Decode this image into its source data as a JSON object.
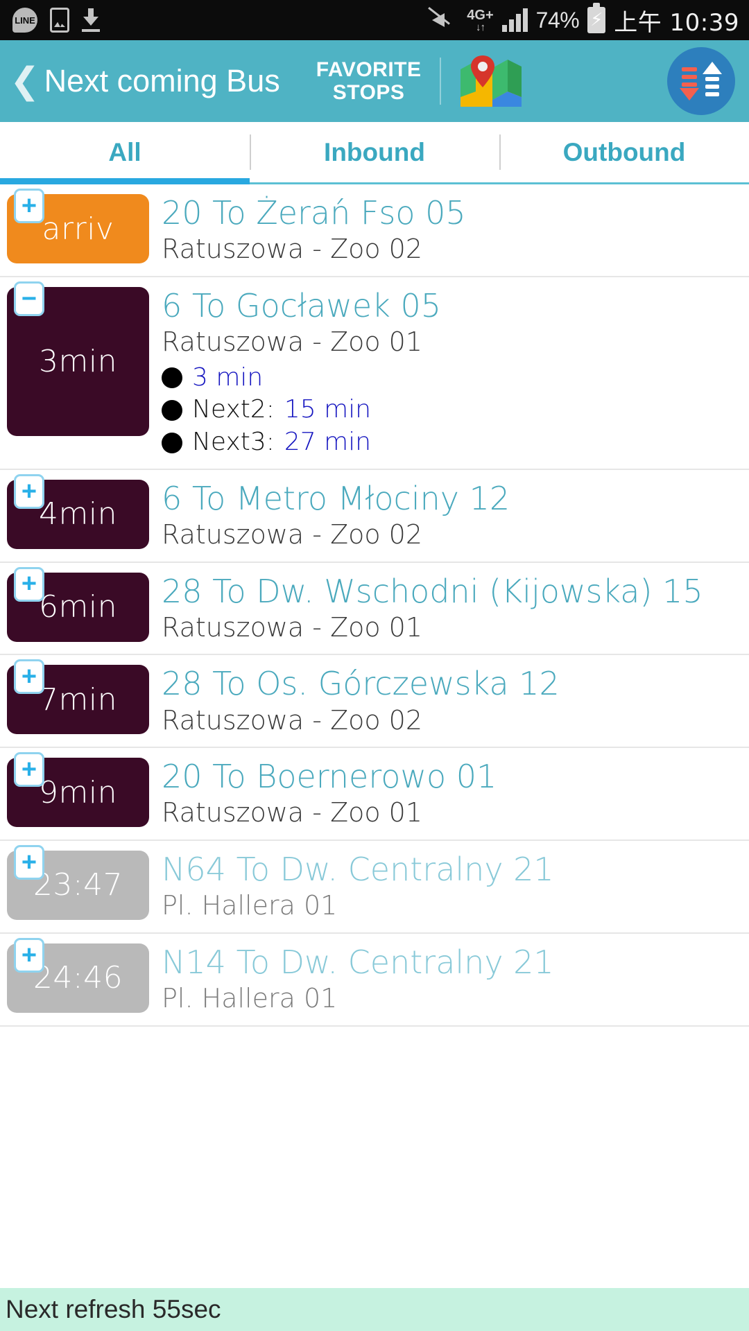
{
  "status_bar": {
    "line_label": "LINE",
    "network": "4G+",
    "network_arrows": "↓↑",
    "battery_percent": "74%",
    "time": "上午 10:39",
    "icons": [
      "line-icon",
      "gallery-icon",
      "download-icon",
      "mute-icon",
      "signal-icon",
      "battery-charging-icon"
    ]
  },
  "appbar": {
    "back_label": "❮",
    "title": "Next coming Bus",
    "favorite_stops_line1": "FAVORITE",
    "favorite_stops_line2": "STOPS",
    "map_icon": "map-icon",
    "sort_icon": "sort-updown-icon",
    "background_color": "#4fb3c4"
  },
  "tabs": [
    {
      "label": "All",
      "active": true
    },
    {
      "label": "Inbound",
      "active": false
    },
    {
      "label": "Outbound",
      "active": false
    }
  ],
  "rows": [
    {
      "badge": "arriv",
      "badge_style": "orange",
      "expander": "+",
      "route": "20 To Żerań Fso 05",
      "stop": "Ratuszowa - Zoo 02",
      "expanded": false,
      "dim": false
    },
    {
      "badge": "3min",
      "badge_style": "dark",
      "expander": "−",
      "route": "6 To Gocławek 05",
      "stop": "Ratuszowa - Zoo 01",
      "expanded": true,
      "dim": false,
      "next_times": [
        {
          "label": "",
          "value": "3 min"
        },
        {
          "label": "Next2:",
          "value": "15 min"
        },
        {
          "label": "Next3:",
          "value": "27 min"
        }
      ]
    },
    {
      "badge": "4min",
      "badge_style": "dark",
      "expander": "+",
      "route": "6 To Metro Młociny 12",
      "stop": "Ratuszowa - Zoo 02",
      "expanded": false,
      "dim": false
    },
    {
      "badge": "6min",
      "badge_style": "dark",
      "expander": "+",
      "route": "28 To Dw. Wschodni (Kijowska) 15",
      "stop": "Ratuszowa - Zoo 01",
      "expanded": false,
      "dim": false
    },
    {
      "badge": "7min",
      "badge_style": "dark",
      "expander": "+",
      "route": "28 To Os. Górczewska 12",
      "stop": "Ratuszowa - Zoo 02",
      "expanded": false,
      "dim": false
    },
    {
      "badge": "9min",
      "badge_style": "dark",
      "expander": "+",
      "route": "20 To Boernerowo 01",
      "stop": "Ratuszowa - Zoo 01",
      "expanded": false,
      "dim": false
    },
    {
      "badge": "23:47",
      "badge_style": "gray",
      "expander": "+",
      "route": "N64 To Dw. Centralny 21",
      "stop": "Pl. Hallera 01",
      "expanded": false,
      "dim": true
    },
    {
      "badge": "24:46",
      "badge_style": "gray",
      "expander": "+",
      "route": "N14 To Dw. Centralny 21",
      "stop": "Pl. Hallera 01",
      "expanded": false,
      "dim": true
    }
  ],
  "footer": {
    "text": "Next refresh 55sec",
    "background_color": "#c6f2e0"
  },
  "colors": {
    "accent_teal": "#4fb3c4",
    "tab_underline": "#29a8e0",
    "badge_orange": "#f08a1d",
    "badge_dark": "#3a0a26",
    "badge_gray": "#b9b9b9",
    "next_value_blue": "#1515c0"
  }
}
